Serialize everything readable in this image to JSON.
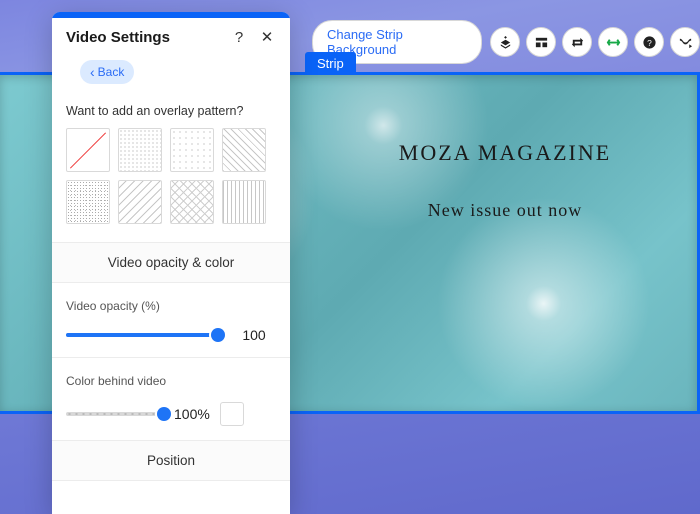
{
  "header": {
    "change_strip_bg": "Change Strip Background",
    "strip_tag": "Strip"
  },
  "strip": {
    "title": "MOZA MAGAZINE",
    "subtitle": "New issue out now"
  },
  "panel": {
    "title": "Video Settings",
    "back": "Back",
    "overlay_question": "Want to add an overlay pattern?",
    "section_opacity_color": "Video opacity & color",
    "video_opacity_label": "Video opacity (%)",
    "video_opacity_value": "100",
    "color_behind_label": "Color behind video",
    "color_behind_value": "100%",
    "section_position": "Position"
  },
  "patterns": [
    "none",
    "dots-small",
    "dots-med",
    "diag1",
    "noise",
    "diag2",
    "cross",
    "vert"
  ],
  "sliders": {
    "opacity_pct": 100,
    "color_pct": 100
  }
}
